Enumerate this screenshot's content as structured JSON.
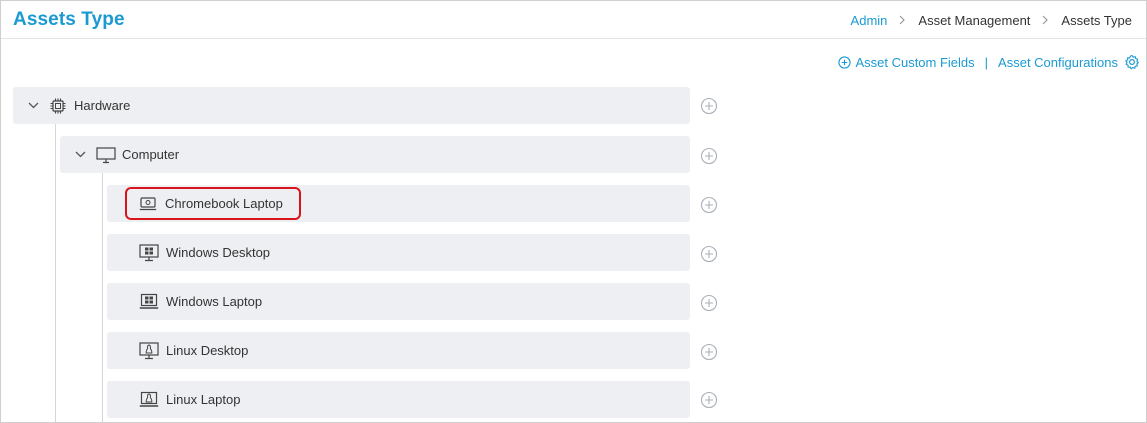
{
  "header": {
    "title": "Assets Type",
    "breadcrumb": [
      {
        "label": "Admin",
        "link": true
      },
      {
        "label": "Asset Management",
        "link": false
      },
      {
        "label": "Assets Type",
        "link": false
      }
    ]
  },
  "actions": {
    "custom_fields_label": "Asset Custom Fields",
    "divider": "|",
    "configurations_label": "Asset Configurations"
  },
  "tree": {
    "root": {
      "label": "Hardware",
      "icon": "chip-icon",
      "expanded": true
    },
    "child": {
      "label": "Computer",
      "icon": "monitor-icon",
      "expanded": true
    },
    "leaves": [
      {
        "label": "Chromebook Laptop",
        "icon": "laptop-icon",
        "highlighted": true
      },
      {
        "label": "Windows Desktop",
        "icon": "windows-desktop-icon"
      },
      {
        "label": "Windows Laptop",
        "icon": "windows-laptop-icon"
      },
      {
        "label": "Linux Desktop",
        "icon": "linux-desktop-icon"
      },
      {
        "label": "Linux Laptop",
        "icon": "linux-laptop-icon"
      }
    ]
  },
  "colors": {
    "accent": "#1b9ad2",
    "row_bg": "#edeff3",
    "highlight": "#d9141b"
  }
}
